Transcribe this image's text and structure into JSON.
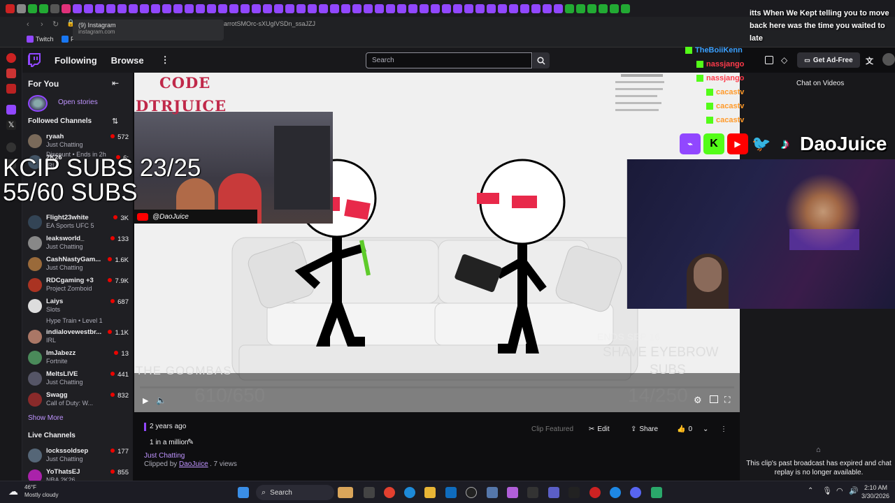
{
  "browser": {
    "tooltip_title": "(9) Instagram",
    "tooltip_url": "instagram.com",
    "url_fragment": "arrotSMOrc-sXUgIVSDn_ssaJZJ",
    "bookmark_twitch": "Twitch",
    "bookmark_f": "F"
  },
  "nav": {
    "following": "Following",
    "browse": "Browse",
    "more": "⋮",
    "search_placeholder": "Search",
    "get_ad_free": "Get Ad-Free"
  },
  "sidebar": {
    "for_you": "For You",
    "open_stories": "Open stories",
    "followed_channels": "Followed Channels",
    "show_more": "Show More",
    "live_channels": "Live Channels",
    "channels": [
      {
        "name": "ryaah",
        "game": "Just Chatting",
        "viewers": "572",
        "color": "#7a6a5a"
      },
      {
        "name": "2K26",
        "game": "IRL",
        "viewers": "6:",
        "color": "#445566"
      },
      {
        "name": "Flight23white",
        "game": "EA Sports UFC 5",
        "viewers": "3K",
        "color": "#334455"
      },
      {
        "name": "leaksworld_",
        "game": "Just Chatting",
        "viewers": "133",
        "color": "#888888"
      },
      {
        "name": "CashNastyGam...",
        "game": "Just Chatting",
        "viewers": "1.6K",
        "color": "#9a6a3a"
      },
      {
        "name": "RDCgaming +3",
        "game": "Project Zomboid",
        "viewers": "7.9K",
        "color": "#aa3322"
      },
      {
        "name": "Laiys",
        "game": "Slots",
        "viewers": "687",
        "color": "#dddddd"
      },
      {
        "name": "indialovewestbr...",
        "game": "IRL",
        "viewers": "1.1K",
        "color": "#aa7766"
      },
      {
        "name": "ImJabezz",
        "game": "Fortnite",
        "viewers": "13",
        "color": "#4a8a5a"
      },
      {
        "name": "MeltsLIVE",
        "game": "Just Chatting",
        "viewers": "441",
        "color": "#555566"
      },
      {
        "name": "Swagg",
        "game": "Call of Duty: W...",
        "viewers": "832",
        "color": "#8a2a2a"
      }
    ],
    "ryaah_sub": "Discount • Ends in 2h",
    "laiys_sub": "Hype Train • Level 1",
    "live": [
      {
        "name": "lockssoldsep",
        "game": "Just Chatting",
        "viewers": "177",
        "color": "#556677"
      },
      {
        "name": "YoThatsEJ",
        "game": "NBA 2K26",
        "viewers": "855",
        "color": "#aa22aa"
      }
    ]
  },
  "overlay": {
    "code_line1": "CODE",
    "code_line2": "DTRJUICE",
    "kcip_line1": "KCIP SUBS 23/25",
    "kcip_line2": "55/60 SUBS",
    "handle": "@DaoJuice",
    "goombas": "THE GOOMBAS",
    "goombas_count": "610/650",
    "ends": "ENDS SEP 16",
    "shave": "SHAVE EYEBROW",
    "subs": "SUBS",
    "shave_count": "14/250",
    "social_name": "DaoJuice",
    "stream_chat": [
      {
        "user": "TheBoiiKenn",
        "text": "itts When We Kept telling you to move back here was the time you waited to late"
      }
    ],
    "chat_names": [
      "TheBoiiKenn",
      "nassjango",
      "nassjango",
      "cacastv",
      "cacastv",
      "cacastv"
    ]
  },
  "clip": {
    "age": "2 years ago",
    "title": "1 in a million",
    "category": "Just Chatting",
    "clipped_by_prefix": "Clipped by",
    "clipper": "DaoJuice",
    "views": ". 7 views",
    "featured": "Clip Featured",
    "edit": "Edit",
    "share": "Share",
    "likes": "0"
  },
  "chat_panel": {
    "title": "Chat on Videos",
    "expired": "This clip's past broadcast has expired and chat replay is no longer available."
  },
  "taskbar": {
    "temp": "46°F",
    "weather": "Mostly cloudy",
    "search": "Search",
    "time": "2:10 AM",
    "date": "3/30/2026"
  },
  "colors": {
    "twitch_purple": "#9147ff",
    "live_red": "#eb0400",
    "kick_green": "#53fc18"
  }
}
